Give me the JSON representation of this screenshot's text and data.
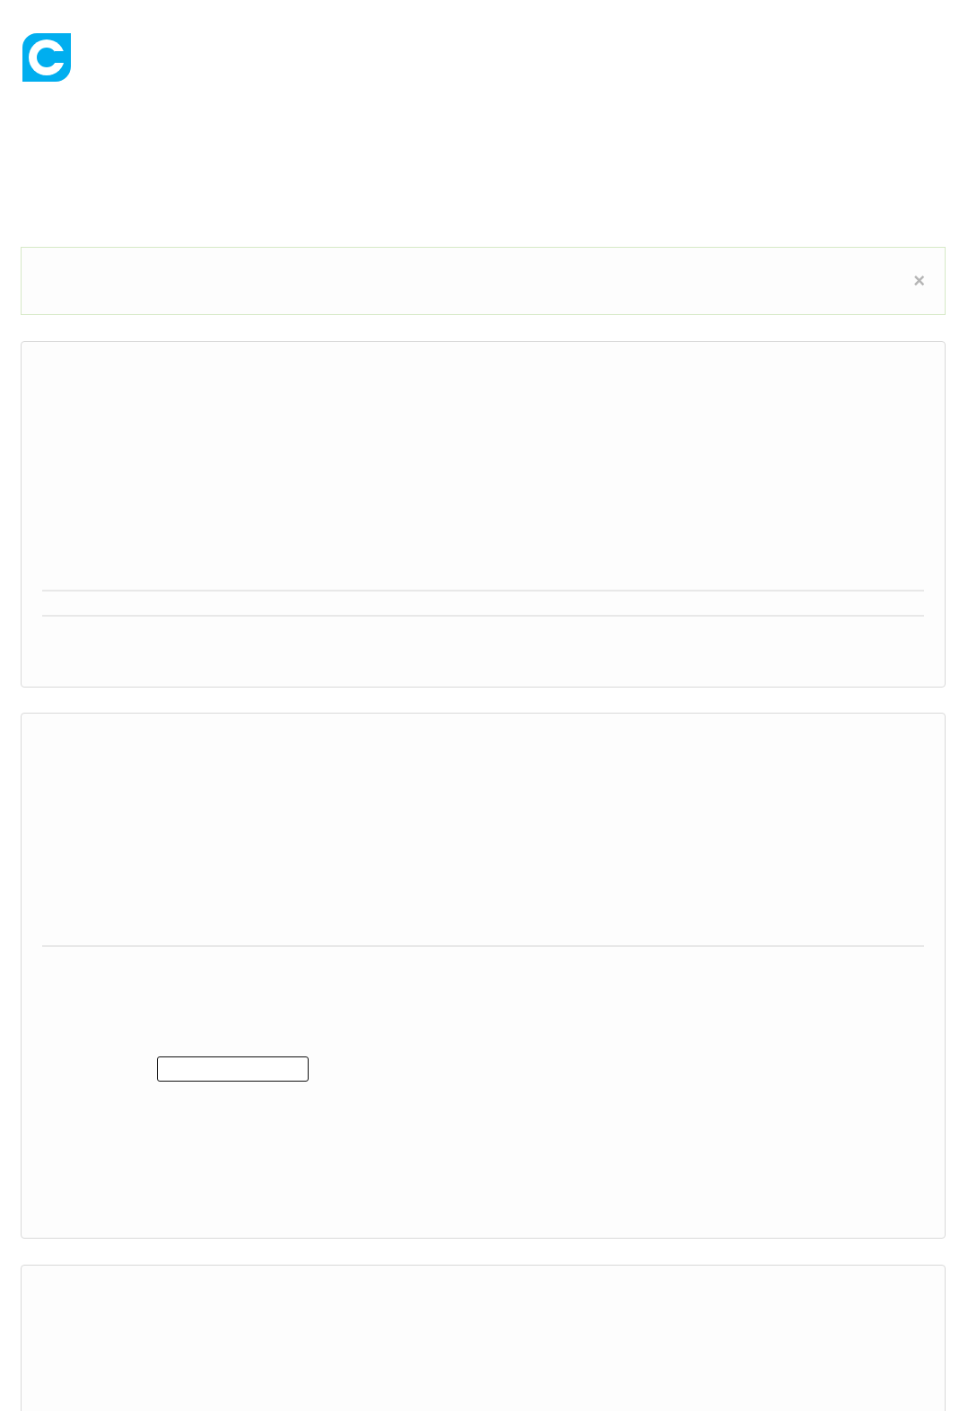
{
  "alert": {
    "close": "×"
  }
}
